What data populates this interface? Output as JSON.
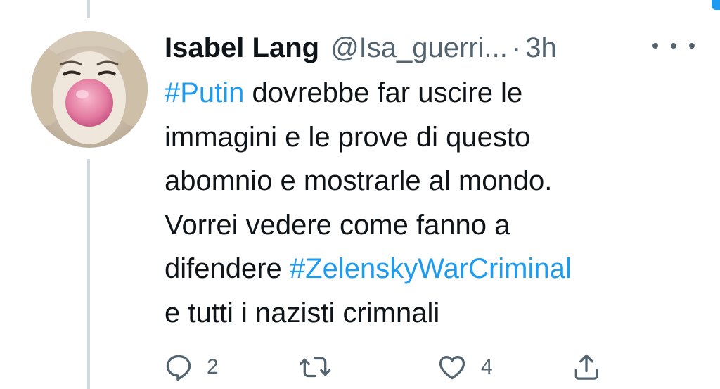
{
  "tweet": {
    "author_name": "Isabel Lang",
    "author_handle": "@Isa_guerri...",
    "separator": "·",
    "time": "3h",
    "body_lines": [
      {
        "tag": "#Putin",
        "text": " dovrebbe far uscire le"
      },
      {
        "text": "immagini e le prove di questo"
      },
      {
        "text": "abomnio e mostrarle al mondo."
      },
      {
        "text": "Vorrei vedere come fanno a"
      },
      {
        "pre": "difendere ",
        "tag": "#ZelenskyWarCriminal"
      },
      {
        "text": "e tutti i nazisti crimnali"
      }
    ]
  },
  "actions": {
    "reply_icon": "reply-icon",
    "reply_count": "2",
    "retweet_icon": "retweet-icon",
    "like_icon": "like-icon",
    "like_count": "4",
    "share_icon": "share-icon"
  },
  "colors": {
    "hashtag": "#1d9bf0",
    "secondary_text": "#536471",
    "primary_text": "#0f1419",
    "thread_line": "#cfd9de"
  }
}
